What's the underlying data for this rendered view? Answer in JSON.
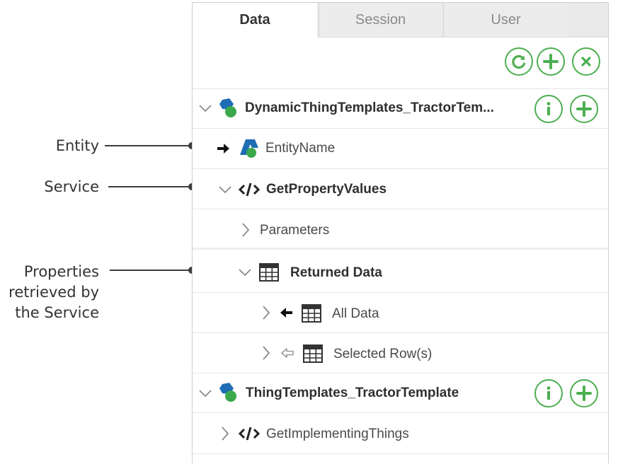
{
  "callouts": {
    "entity": "Entity",
    "service": "Service",
    "properties_line1": "Properties",
    "properties_line2": "retrieved by",
    "properties_line3": "the Service"
  },
  "tabs": [
    {
      "label": "Data",
      "active": true
    },
    {
      "label": "Session",
      "active": false
    },
    {
      "label": "User",
      "active": false
    }
  ],
  "toolbar": {
    "refresh_icon": "refresh-icon",
    "add_icon": "plus-icon",
    "remove_icon": "close-icon"
  },
  "tree": {
    "dynamic_template": "DynamicThingTemplates_TractorTem...",
    "entity_name": "EntityName",
    "service_name": "GetPropertyValues",
    "parameters": "Parameters",
    "returned_data": "Returned Data",
    "all_data": "All Data",
    "selected_rows": "Selected Row(s)",
    "thing_template": "ThingTemplates_TractorTemplate",
    "implementing_things": "GetImplementingThings"
  },
  "colors": {
    "accent_green": "#4caf50",
    "entity_blue": "#1f6db5",
    "entity_green": "#3aa84b"
  }
}
